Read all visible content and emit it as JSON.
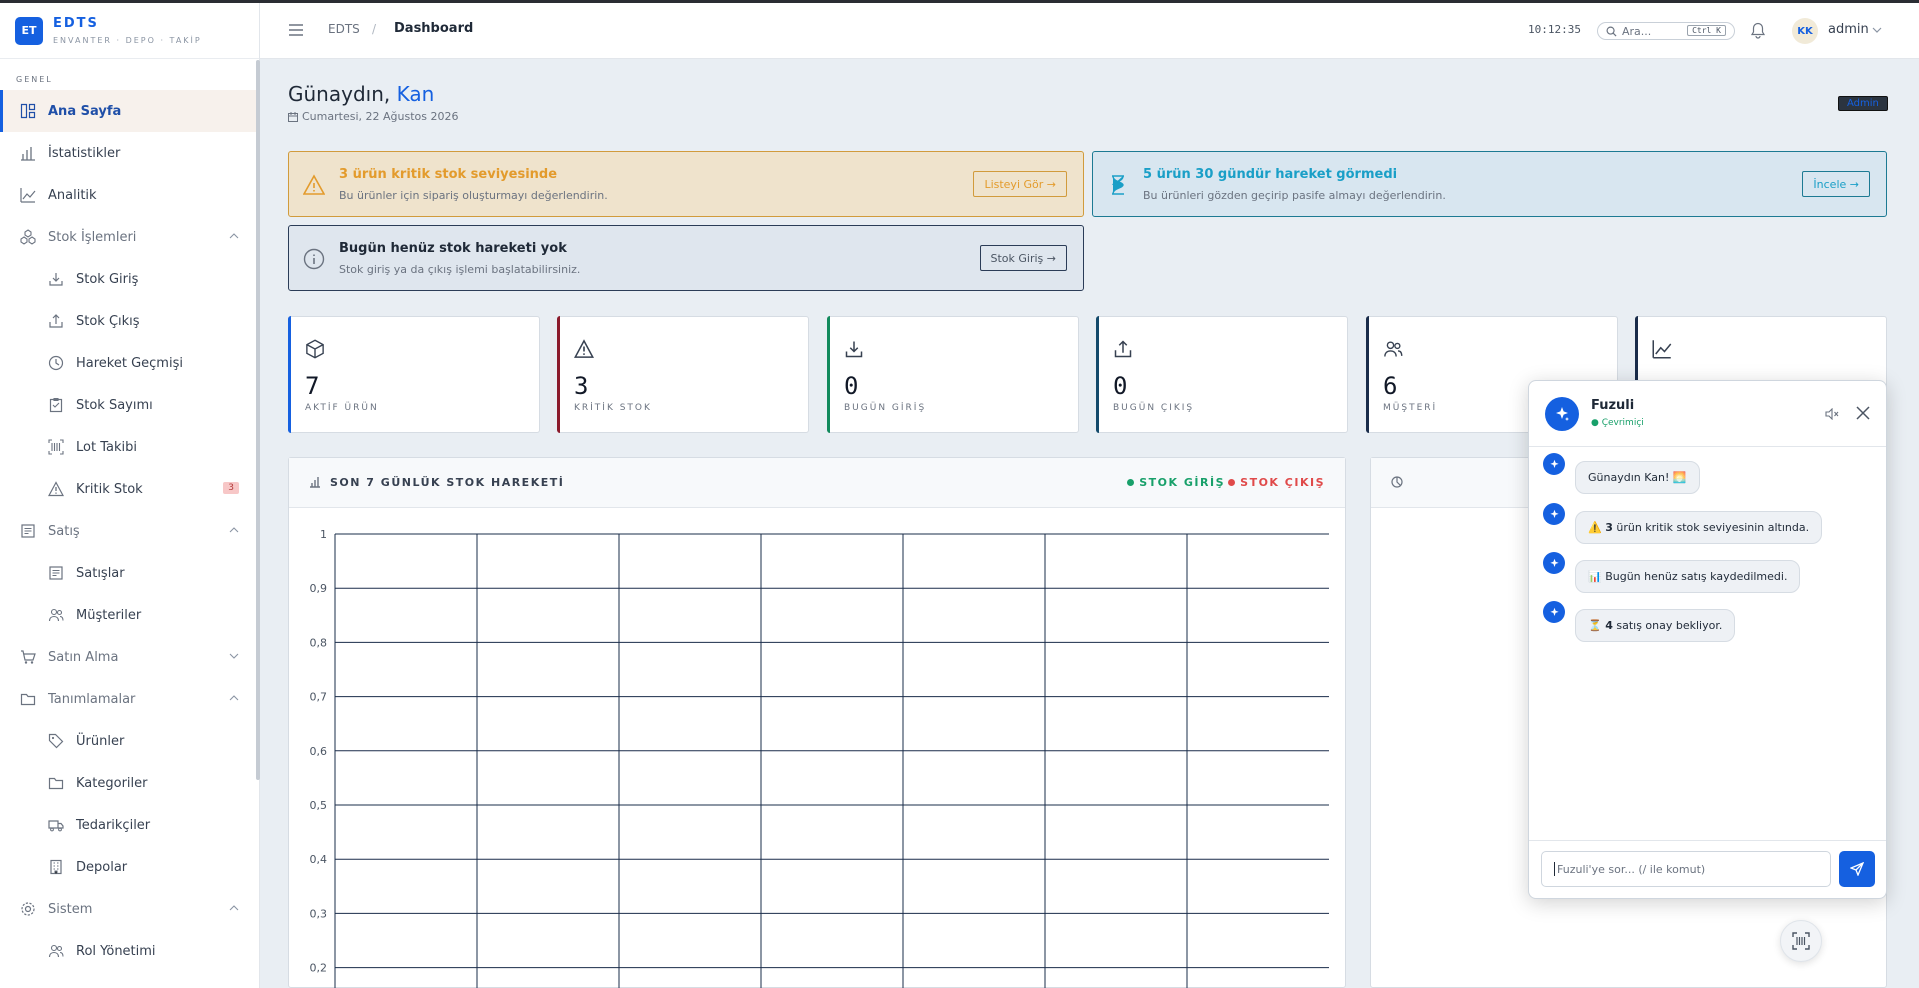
{
  "brand": {
    "logo": "ET",
    "name": "EDTS",
    "subtitle": "ENVANTER · DEPO · TAKİP"
  },
  "sidebar": {
    "section": "GENEL",
    "items": [
      {
        "label": "Ana Sayfa",
        "icon": "dashboard-icon",
        "active": true
      },
      {
        "label": "İstatistikler",
        "icon": "bar-chart-icon"
      },
      {
        "label": "Analitik",
        "icon": "line-chart-icon"
      },
      {
        "label": "Stok İşlemleri",
        "icon": "boxes-icon",
        "group": true
      },
      {
        "label": "Stok Giriş",
        "icon": "download-icon",
        "sub": true
      },
      {
        "label": "Stok Çıkış",
        "icon": "upload-icon",
        "sub": true
      },
      {
        "label": "Hareket Geçmişi",
        "icon": "clock-icon",
        "sub": true
      },
      {
        "label": "Stok Sayımı",
        "icon": "clipboard-icon",
        "sub": true
      },
      {
        "label": "Lot Takibi",
        "icon": "barcode-icon",
        "sub": true
      },
      {
        "label": "Kritik Stok",
        "icon": "warning-icon",
        "sub": true,
        "badge": "3"
      },
      {
        "label": "Satış",
        "icon": "receipt-icon",
        "group": true
      },
      {
        "label": "Satışlar",
        "icon": "receipt-icon",
        "sub": true
      },
      {
        "label": "Müşteriler",
        "icon": "users-icon",
        "sub": true
      },
      {
        "label": "Satın Alma",
        "icon": "cart-icon",
        "group": true
      },
      {
        "label": "Tanımlamalar",
        "icon": "folder-icon",
        "group": true
      },
      {
        "label": "Ürünler",
        "icon": "tag-icon",
        "sub": true
      },
      {
        "label": "Kategoriler",
        "icon": "folder-icon",
        "sub": true
      },
      {
        "label": "Tedarikçiler",
        "icon": "truck-icon",
        "sub": true
      },
      {
        "label": "Depolar",
        "icon": "building-icon",
        "sub": true
      },
      {
        "label": "Sistem",
        "icon": "gear-icon",
        "group": true
      },
      {
        "label": "Rol Yönetimi",
        "icon": "users-icon",
        "sub": true
      }
    ]
  },
  "header": {
    "breadcrumb_root": "EDTS",
    "breadcrumb_sep": "/",
    "breadcrumb_current": "Dashboard",
    "clock": "10:12:35",
    "search_placeholder": "Ara...",
    "search_shortcut": "Ctrl K",
    "avatar_initials": "KK",
    "username": "admin"
  },
  "page": {
    "greeting": "Günaydın,",
    "name": "Kan",
    "date": "Cumartesi, 22 Ağustos 2026",
    "role_badge": "Admin"
  },
  "alerts": {
    "critical": {
      "title": "3 ürün kritik stok seviyesinde",
      "desc": "Bu ürünler için sipariş oluşturmayı değerlendirin.",
      "button": "Listeyi Gör →"
    },
    "idle": {
      "title": "5 ürün 30 gündür hareket görmedi",
      "desc": "Bu ürünleri gözden geçirip pasife almayı değerlendirin.",
      "button": "İncele →"
    },
    "nomove": {
      "title": "Bugün henüz stok hareketi yok",
      "desc": "Stok giriş ya da çıkış işlemi başlatabilirsiniz.",
      "button": "Stok Giriş →"
    }
  },
  "stats": [
    {
      "value": "7",
      "label": "AKTİF ÜRÜN",
      "icon": "box-icon"
    },
    {
      "value": "3",
      "label": "KRİTİK STOK",
      "icon": "warning-icon"
    },
    {
      "value": "0",
      "label": "BUGÜN GİRİŞ",
      "icon": "download-icon"
    },
    {
      "value": "0",
      "label": "BUGÜN ÇIKIŞ",
      "icon": "upload-icon"
    },
    {
      "value": "6",
      "label": "MÜŞTERİ",
      "icon": "users-icon"
    },
    {
      "value": "",
      "label": "",
      "icon": "line-chart-icon"
    }
  ],
  "chart_panel": {
    "title": "SON 7 GÜNLÜK STOK HAREKETİ",
    "legend_in": "STOK GİRİŞ",
    "legend_out": "STOK ÇIKIŞ"
  },
  "chart_data": {
    "type": "line",
    "title": "SON 7 GÜNLÜK STOK HAREKETİ",
    "xlabel": "",
    "ylabel": "",
    "ylim": [
      0,
      1
    ],
    "y_tick_labels": [
      "1",
      "0,9",
      "0,8",
      "0,7",
      "0,6",
      "0,5",
      "0,4",
      "0,3",
      "0,2"
    ],
    "x_grid_columns": 7,
    "grid": true,
    "legend": "top-right",
    "series": [
      {
        "name": "STOK GİRİŞ",
        "color": "#18a06a",
        "values": []
      },
      {
        "name": "STOK ÇIKIŞ",
        "color": "#e04a4a",
        "values": []
      }
    ]
  },
  "chat": {
    "name": "Fuzuli",
    "status": "● Çevrimiçi",
    "messages": [
      {
        "pre": "Günaydın Kan! 🌅",
        "bold": "",
        "post": ""
      },
      {
        "pre": "⚠️ ",
        "bold": "3",
        "post": " ürün kritik stok seviyesinin altında."
      },
      {
        "pre": "📊 Bugün henüz satış kaydedilmedi.",
        "bold": "",
        "post": ""
      },
      {
        "pre": "⏳ ",
        "bold": "4",
        "post": " satış onay bekliyor."
      }
    ],
    "input_placeholder": "Fuzuli'ye sor... (/ ile komut)"
  },
  "colors": {
    "accent": "#1560e0",
    "warning": "#e39b2c",
    "info": "#1a9fc7",
    "success": "#18a06a",
    "danger": "#e04a4a"
  }
}
